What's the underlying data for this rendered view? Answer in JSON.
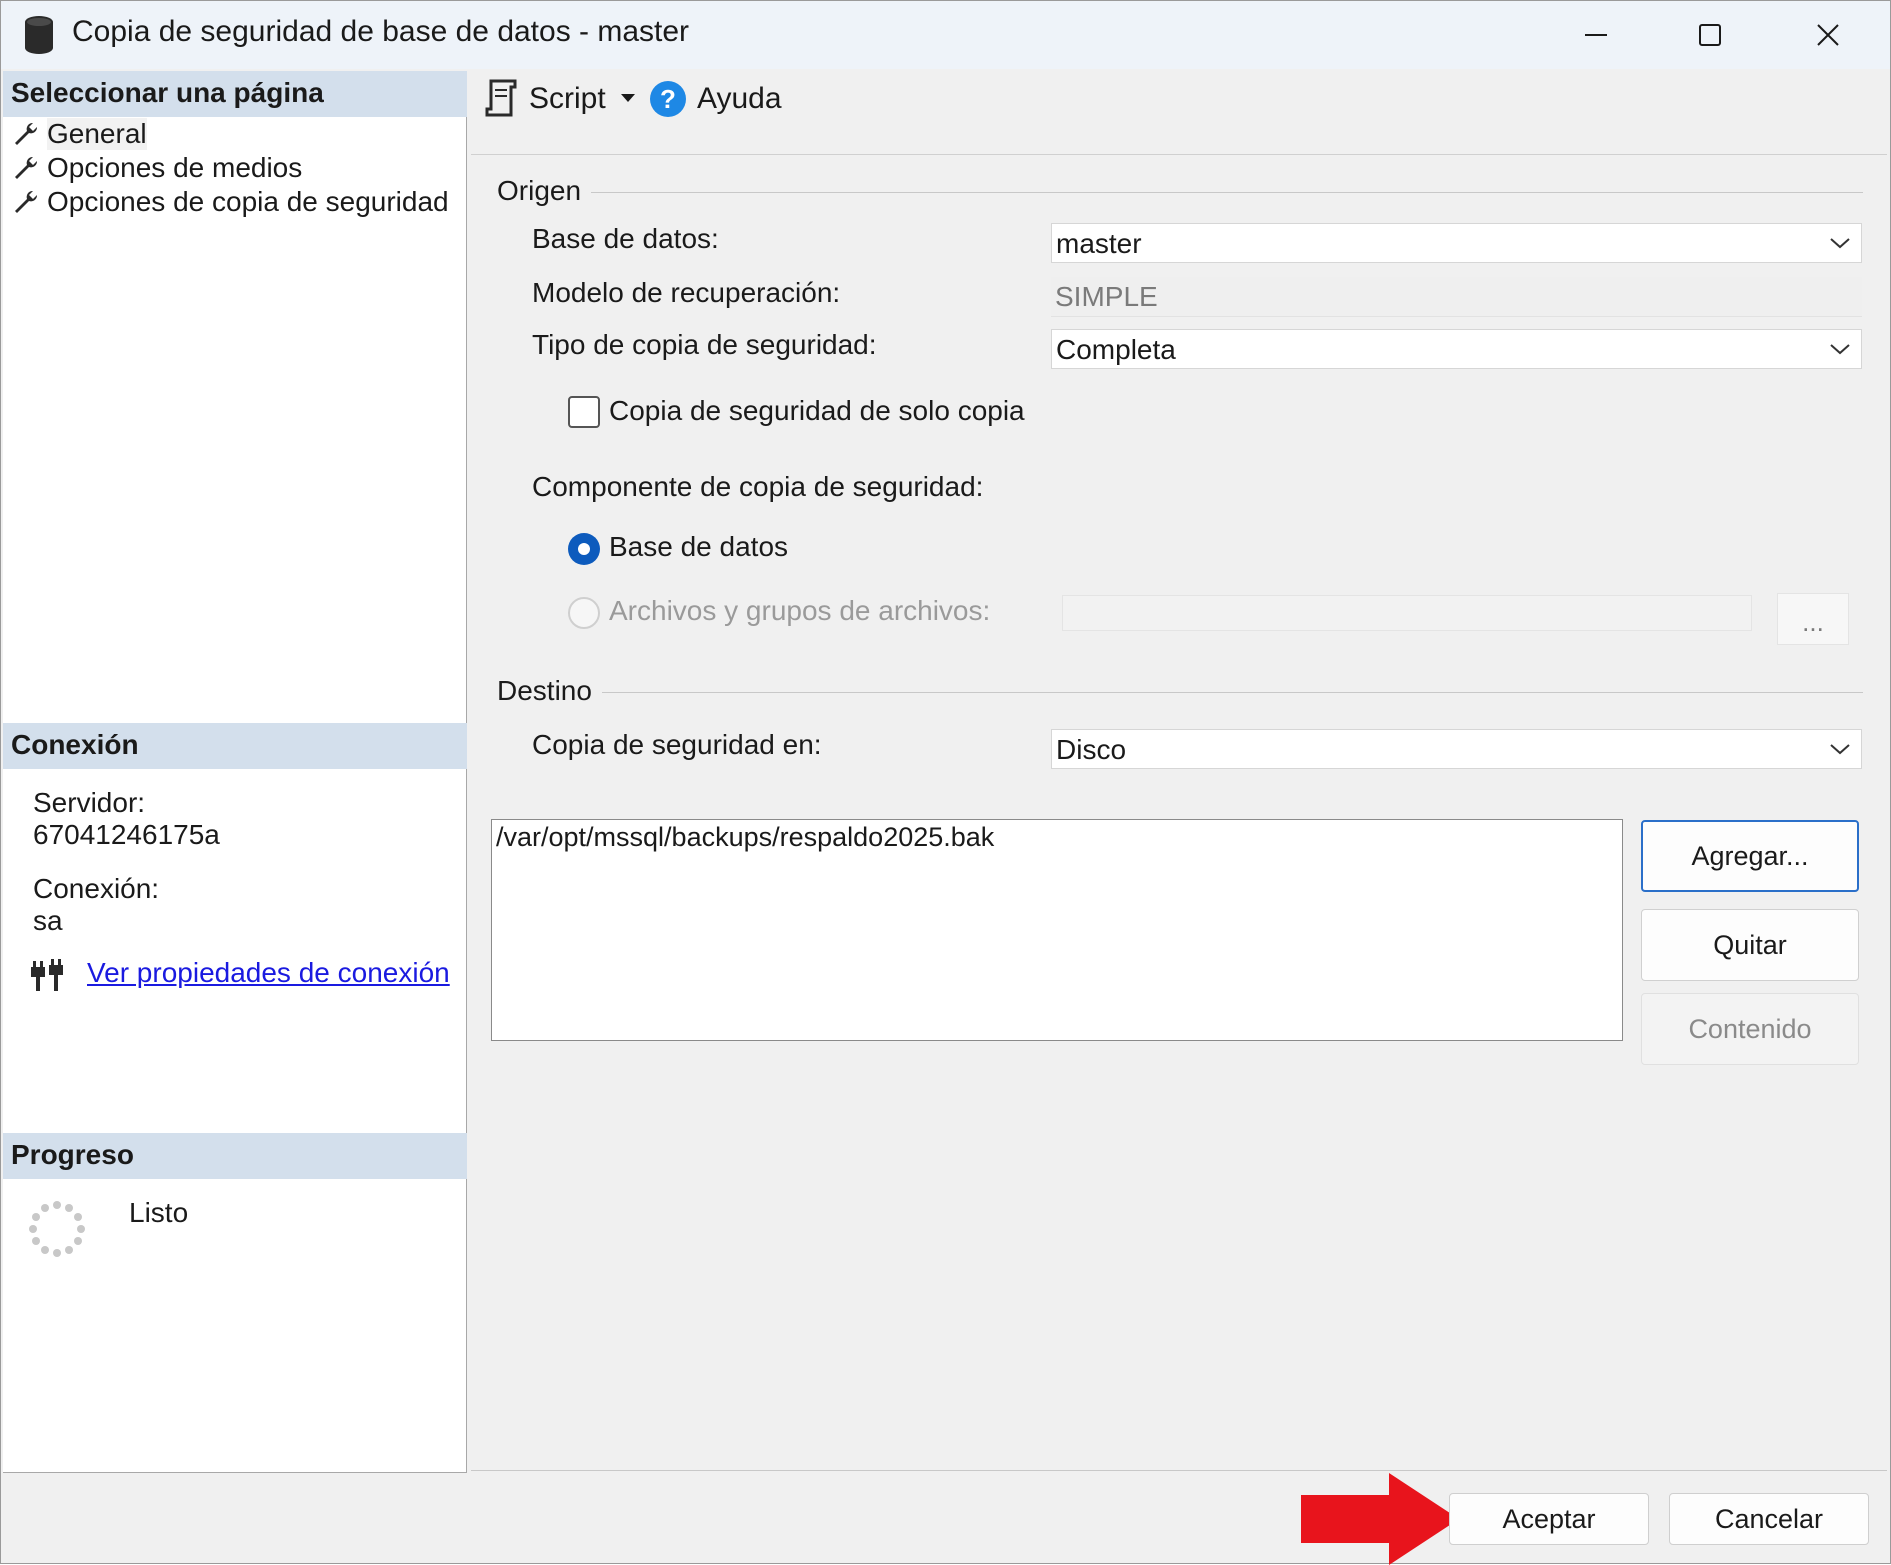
{
  "window": {
    "title": "Copia de seguridad de base de datos - master",
    "icons": {
      "app": "database-icon",
      "minimize": "minimize-icon",
      "maximize": "maximize-icon",
      "close": "close-icon"
    }
  },
  "left_panel": {
    "select_page": {
      "header": "Seleccionar una página",
      "items": [
        {
          "label": "General",
          "selected": true
        },
        {
          "label": "Opciones de medios",
          "selected": false
        },
        {
          "label": "Opciones de copia de seguridad",
          "selected": false
        }
      ]
    },
    "connection": {
      "header": "Conexión",
      "server_label": "Servidor:",
      "server_value": "67041246175a",
      "connection_label": "Conexión:",
      "connection_value": "sa",
      "link_text": "Ver propiedades de conexión"
    },
    "progress": {
      "header": "Progreso",
      "status": "Listo"
    }
  },
  "toolbar": {
    "script_label": "Script",
    "help_label": "Ayuda"
  },
  "source": {
    "group_label": "Origen",
    "database_label": "Base de datos:",
    "database_value": "master",
    "recovery_label": "Modelo de recuperación:",
    "recovery_value": "SIMPLE",
    "backup_type_label": "Tipo de copia de seguridad:",
    "backup_type_value": "Completa",
    "copy_only_label": "Copia de seguridad de solo copia",
    "copy_only_checked": false,
    "component_label": "Componente de copia de seguridad:",
    "component_options": [
      {
        "label": "Base de datos",
        "selected": true,
        "enabled": true
      },
      {
        "label": "Archivos y grupos de archivos:",
        "selected": false,
        "enabled": false
      }
    ],
    "browse_button": "..."
  },
  "destination": {
    "group_label": "Destino",
    "backup_to_label": "Copia de seguridad en:",
    "backup_to_value": "Disco",
    "paths": [
      "/var/opt/mssql/backups/respaldo2025.bak"
    ],
    "add_button": "Agregar...",
    "remove_button": "Quitar",
    "contents_button": "Contenido"
  },
  "footer": {
    "ok_button": "Aceptar",
    "cancel_button": "Cancelar"
  },
  "colors": {
    "section_header_bg": "#d3dfec",
    "title_bar_bg": "#eef3f9",
    "radio_selected": "#0d5bbd",
    "link": "#1a1ae0",
    "annotation_arrow": "#e8141c"
  }
}
